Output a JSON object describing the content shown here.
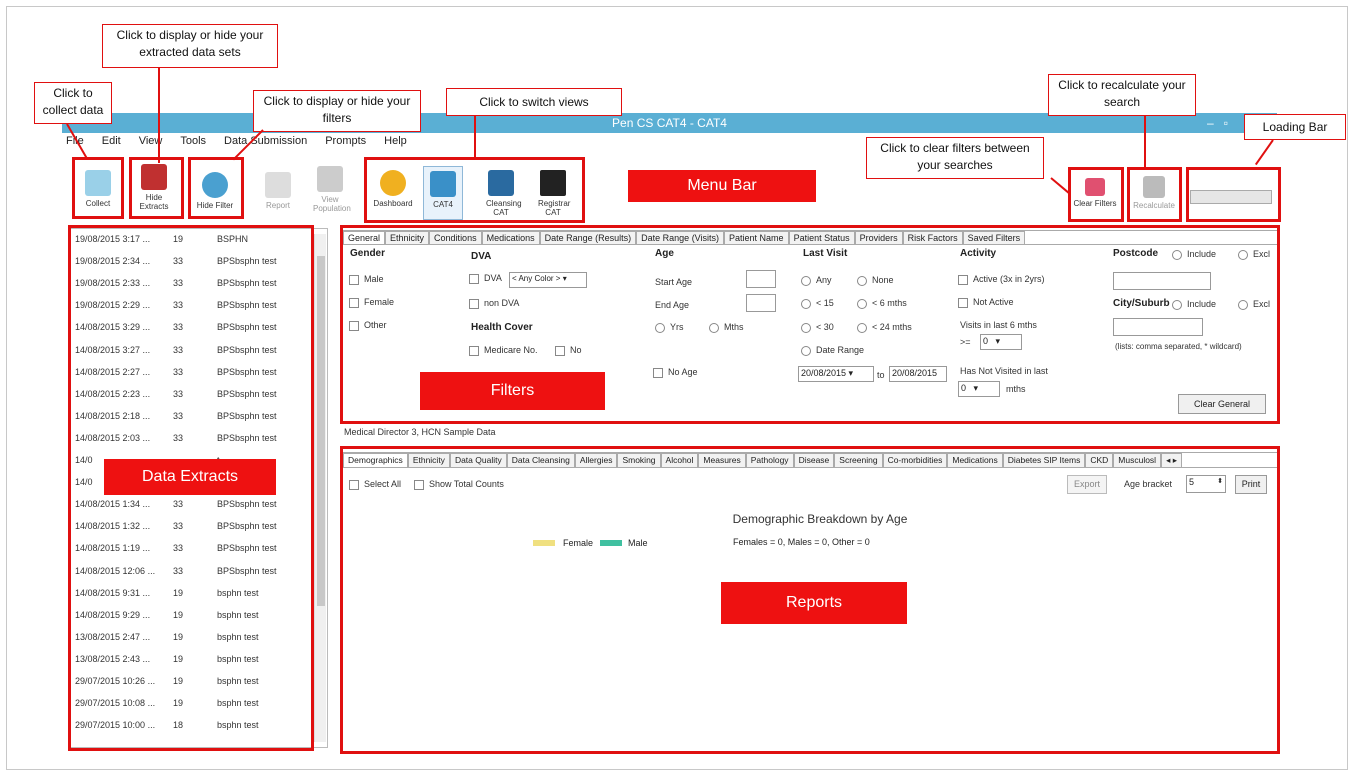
{
  "app": {
    "title": "Pen CS CAT4 - CAT4"
  },
  "menu": [
    "File",
    "Edit",
    "View",
    "Tools",
    "Data Submission",
    "Prompts",
    "Help"
  ],
  "toolbar": {
    "collect": "Collect",
    "hide_extracts": "Hide Extracts",
    "hide_filter": "Hide Filter",
    "report": "Report",
    "view_population": "View Population",
    "dashboard": "Dashboard",
    "cat4": "CAT4",
    "cleansing_cat": "Cleansing CAT",
    "registrar_cat": "Registrar CAT",
    "clear_filters": "Clear Filters",
    "recalculate": "Recalculate"
  },
  "callouts": {
    "collect": "Click to collect data",
    "extracts": "Click to display or hide your extracted data sets",
    "filters": "Click to display or hide your filters",
    "views": "Click to switch views",
    "recalculate": "Click to recalculate your search",
    "clear": "Click to clear filters between your searches",
    "loading": "Loading Bar"
  },
  "labels": {
    "menu_bar": "Menu Bar",
    "filters": "Filters",
    "data_extracts": "Data Extracts",
    "reports": "Reports"
  },
  "extracts": [
    {
      "date": "19/08/2015 3:17 ...",
      "n": "19",
      "name": "BSPHN"
    },
    {
      "date": "19/08/2015 2:34 ...",
      "n": "33",
      "name": "BPSbsphn test"
    },
    {
      "date": "19/08/2015 2:33 ...",
      "n": "33",
      "name": "BPSbsphn test"
    },
    {
      "date": "19/08/2015 2:29 ...",
      "n": "33",
      "name": "BPSbsphn test"
    },
    {
      "date": "14/08/2015 3:29 ...",
      "n": "33",
      "name": "BPSbsphn test"
    },
    {
      "date": "14/08/2015 3:27 ...",
      "n": "33",
      "name": "BPSbsphn test"
    },
    {
      "date": "14/08/2015 2:27 ...",
      "n": "33",
      "name": "BPSbsphn test"
    },
    {
      "date": "14/08/2015 2:23 ...",
      "n": "33",
      "name": "BPSbsphn test"
    },
    {
      "date": "14/08/2015 2:18 ...",
      "n": "33",
      "name": "BPSbsphn test"
    },
    {
      "date": "14/08/2015 2:03 ...",
      "n": "33",
      "name": "BPSbsphn test"
    },
    {
      "date": "14/0",
      "n": "",
      "name": "t"
    },
    {
      "date": "14/0",
      "n": "",
      "name": "t"
    },
    {
      "date": "14/08/2015 1:34 ...",
      "n": "33",
      "name": "BPSbsphn test"
    },
    {
      "date": "14/08/2015 1:32 ...",
      "n": "33",
      "name": "BPSbsphn test"
    },
    {
      "date": "14/08/2015 1:19 ...",
      "n": "33",
      "name": "BPSbsphn test"
    },
    {
      "date": "14/08/2015 12:06 ...",
      "n": "33",
      "name": "BPSbsphn test"
    },
    {
      "date": "14/08/2015 9:31 ...",
      "n": "19",
      "name": "bsphn test"
    },
    {
      "date": "14/08/2015 9:29 ...",
      "n": "19",
      "name": "bsphn test"
    },
    {
      "date": "13/08/2015 2:47 ...",
      "n": "19",
      "name": "bsphn test"
    },
    {
      "date": "13/08/2015 2:43 ...",
      "n": "19",
      "name": "bsphn test"
    },
    {
      "date": "29/07/2015 10:26 ...",
      "n": "19",
      "name": "bsphn test"
    },
    {
      "date": "29/07/2015 10:08 ...",
      "n": "19",
      "name": "bsphn test"
    },
    {
      "date": "29/07/2015 10:00 ...",
      "n": "18",
      "name": "bsphn test"
    }
  ],
  "filter_tabs": [
    "General",
    "Ethnicity",
    "Conditions",
    "Medications",
    "Date Range (Results)",
    "Date Range (Visits)",
    "Patient Name",
    "Patient Status",
    "Providers",
    "Risk Factors",
    "Saved Filters"
  ],
  "filters": {
    "gender_h": "Gender",
    "male": "Male",
    "female": "Female",
    "other": "Other",
    "dva_h": "DVA",
    "dva": "DVA",
    "dva_color": "< Any Color >",
    "non_dva": "non DVA",
    "health_cover_h": "Health Cover",
    "medicare": "Medicare No.",
    "no": "No",
    "age_h": "Age",
    "start_age": "Start Age",
    "end_age": "End Age",
    "yrs": "Yrs",
    "mths": "Mths",
    "no_age": "No Age",
    "last_visit_h": "Last Visit",
    "any": "Any",
    "none": "None",
    "lt15": "< 15",
    "lt6m": "< 6 mths",
    "lt30": "< 30",
    "lt24m": "< 24 mths",
    "date_range": "Date Range",
    "from_date": "20/08/2015",
    "to": "to",
    "to_date": "20/08/2015",
    "activity_h": "Activity",
    "active": "Active (3x in 2yrs)",
    "not_active": "Not Active",
    "visits_last": "Visits in last 6 mths",
    "ge": ">=",
    "visits_val": "0",
    "not_visited": "Has Not Visited in last",
    "nv_val": "0",
    "mths_lbl": "mths",
    "postcode_h": "Postcode",
    "include": "Include",
    "excl": "Excl",
    "city_h": "City/Suburb",
    "include2": "Include",
    "excl2": "Excl",
    "lists_note": "(lists: comma separated, * wildcard)",
    "clear_general": "Clear General"
  },
  "source_line": "Medical Director 3, HCN Sample Data",
  "report_tabs": [
    "Demographics",
    "Ethnicity",
    "Data Quality",
    "Data Cleansing",
    "Allergies",
    "Smoking",
    "Alcohol",
    "Measures",
    "Pathology",
    "Disease",
    "Screening",
    "Co-morbidities",
    "Medications",
    "Diabetes SIP Items",
    "CKD",
    "Musculosl"
  ],
  "reports": {
    "select_all": "Select All",
    "show_total": "Show Total Counts",
    "export": "Export",
    "age_bracket": "Age bracket",
    "age_bracket_val": "5",
    "print": "Print",
    "chart_title": "Demographic Breakdown by Age",
    "legend_female": "Female",
    "legend_male": "Male",
    "summary": "Females = 0, Males = 0, Other = 0"
  },
  "colors": {
    "accent": "#e01010",
    "titlebar": "#5aafd4",
    "female": "#f0e080",
    "male": "#40c0a0"
  }
}
